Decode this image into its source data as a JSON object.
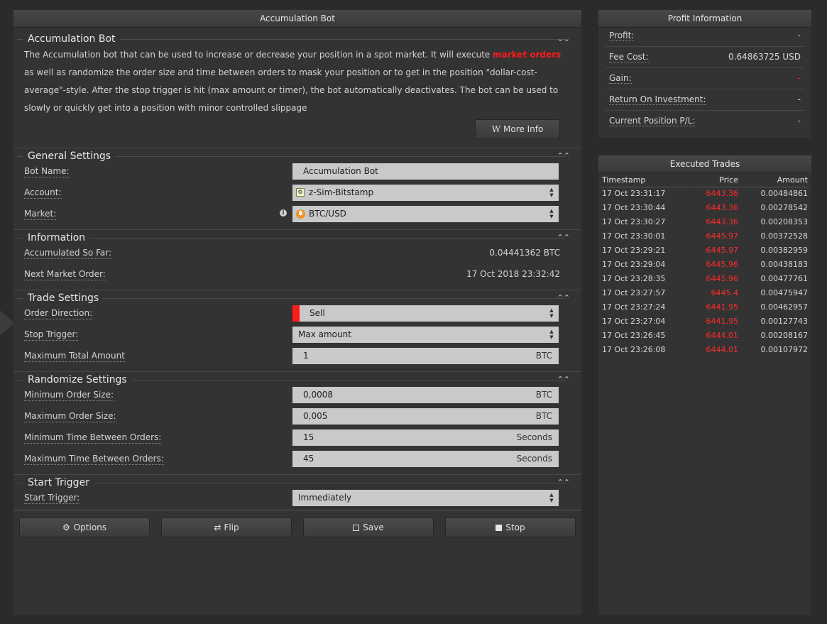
{
  "main": {
    "title": "Accumulation Bot",
    "intro": {
      "heading": "Accumulation Bot",
      "text_before": "The Accumulation bot that can be used to increase or decrease your position in a spot market. It will execute ",
      "highlight": "market orders",
      "text_after": " as well as randomize the order size and time between orders to mask your position or to get in the position \"dollar-cost-average\"-style. After the stop trigger is hit (max amount or timer), the bot automatically deactivates. The bot can be used to slowly or quickly get into a position with minor controlled slippage",
      "more_info_label": "More Info"
    },
    "general": {
      "heading": "General Settings",
      "bot_name_label": "Bot Name:",
      "bot_name_value": "Accumulation Bot",
      "account_label": "Account:",
      "account_value": "z-Sim-Bitstamp",
      "market_label": "Market:",
      "market_value": "BTC/USD"
    },
    "information": {
      "heading": "Information",
      "accumulated_label": "Accumulated So Far:",
      "accumulated_value": "0.04441362 BTC",
      "next_order_label": "Next Market Order:",
      "next_order_value": "17 Oct 2018 23:32:42"
    },
    "trade": {
      "heading": "Trade Settings",
      "direction_label": "Order Direction:",
      "direction_value": "Sell",
      "stop_trigger_label": "Stop Trigger:",
      "stop_trigger_value": "Max amount",
      "max_total_label": "Maximum Total Amount",
      "max_total_value": "1",
      "max_total_unit": "BTC"
    },
    "randomize": {
      "heading": "Randomize Settings",
      "min_size_label": "Minimum Order Size:",
      "min_size_value": "0,0008",
      "min_size_unit": "BTC",
      "max_size_label": "Maximum Order Size:",
      "max_size_value": "0,005",
      "max_size_unit": "BTC",
      "min_time_label": "Minimum Time Between Orders:",
      "min_time_value": "15",
      "min_time_unit": "Seconds",
      "max_time_label": "Maximum Time Between Orders:",
      "max_time_value": "45",
      "max_time_unit": "Seconds"
    },
    "start": {
      "heading": "Start Trigger",
      "label": "Start Trigger:",
      "value": "Immediately"
    },
    "buttons": {
      "options": "Options",
      "flip": "Flip",
      "save": "Save",
      "stop": "Stop"
    }
  },
  "profit": {
    "title": "Profit Information",
    "rows": [
      {
        "label": "Profit:",
        "value": "-"
      },
      {
        "label": "Fee Cost:",
        "value": "0.64863725 USD"
      },
      {
        "label": "Gain:",
        "value": "-"
      },
      {
        "label": "Return On Investment:",
        "value": "-"
      },
      {
        "label": "Current Position P/L:",
        "value": "-"
      }
    ]
  },
  "trades": {
    "title": "Executed Trades",
    "headers": {
      "timestamp": "Timestamp",
      "price": "Price",
      "amount": "Amount"
    },
    "rows": [
      {
        "ts": "17 Oct 23:31:17",
        "price": "6443.36",
        "amount": "0.00484861"
      },
      {
        "ts": "17 Oct 23:30:44",
        "price": "6443.36",
        "amount": "0.00278542"
      },
      {
        "ts": "17 Oct 23:30:27",
        "price": "6443.36",
        "amount": "0.00208353"
      },
      {
        "ts": "17 Oct 23:30:01",
        "price": "6445.97",
        "amount": "0.00372528"
      },
      {
        "ts": "17 Oct 23:29:21",
        "price": "6445.97",
        "amount": "0.00382959"
      },
      {
        "ts": "17 Oct 23:29:04",
        "price": "6445.96",
        "amount": "0.00438183"
      },
      {
        "ts": "17 Oct 23:28:35",
        "price": "6445.96",
        "amount": "0.00477761"
      },
      {
        "ts": "17 Oct 23:27:57",
        "price": "6445.4",
        "amount": "0.00475947"
      },
      {
        "ts": "17 Oct 23:27:24",
        "price": "6441.95",
        "amount": "0.00462957"
      },
      {
        "ts": "17 Oct 23:27:04",
        "price": "6441.95",
        "amount": "0.00127743"
      },
      {
        "ts": "17 Oct 23:26:45",
        "price": "6444.01",
        "amount": "0.00208167"
      },
      {
        "ts": "17 Oct 23:26:08",
        "price": "6444.01",
        "amount": "0.00107972"
      }
    ]
  },
  "colors": {
    "accent_red": "#ff1a1a",
    "panel_bg": "#333333",
    "field_bg": "#c9c9c9",
    "bitcoin_orange": "#f7931a"
  },
  "icons": {
    "collapse": "chevron-double-up-icon",
    "expand": "chevron-double-down-icon",
    "options": "gear-icon",
    "flip": "shuffle-icon",
    "save": "floppy-icon",
    "stop": "stop-square-icon",
    "more_info": "wikipedia-icon"
  }
}
